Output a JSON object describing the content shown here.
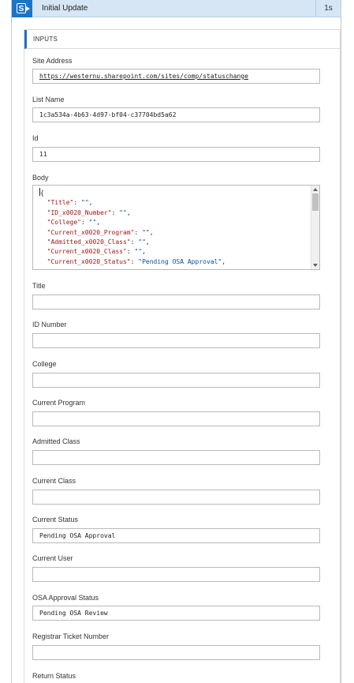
{
  "header": {
    "title": "Initial Update",
    "duration": "1s",
    "icon": "sharepoint-icon",
    "accent_color": "#1e74c4",
    "header_bg": "#d6e6f5"
  },
  "inputs": {
    "section_label": "INPUTS",
    "site_address": {
      "label": "Site Address",
      "value": "https://westernu.sharepoint.com/sites/comp/statuschange"
    },
    "list_name": {
      "label": "List Name",
      "value": "1c3a534a-4b63-4d97-bf04-c37704bd5a62"
    },
    "id": {
      "label": "Id",
      "value": "11"
    },
    "body": {
      "label": "Body",
      "open_brace": "{",
      "lines": [
        {
          "key": "\"Title\"",
          "value": "\"\""
        },
        {
          "key": "\"ID_x0020_Number\"",
          "value": "\"\""
        },
        {
          "key": "\"College\"",
          "value": "\"\""
        },
        {
          "key": "\"Current_x0020_Program\"",
          "value": "\"\""
        },
        {
          "key": "\"Admitted_x0020_Class\"",
          "value": "\"\""
        },
        {
          "key": "\"Current_x0020_Class\"",
          "value": "\"\""
        },
        {
          "key": "\"Current_x0020_Status\"",
          "value": "\"Pending OSA Approval\""
        }
      ]
    },
    "title": {
      "label": "Title",
      "value": ""
    },
    "id_number": {
      "label": "ID Number",
      "value": ""
    },
    "college": {
      "label": "College",
      "value": ""
    },
    "current_program": {
      "label": "Current Program",
      "value": ""
    },
    "admitted_class": {
      "label": "Admitted Class",
      "value": ""
    },
    "current_class": {
      "label": "Current Class",
      "value": ""
    },
    "current_status": {
      "label": "Current Status",
      "value": "Pending OSA Approval"
    },
    "current_user": {
      "label": "Current User",
      "value": ""
    },
    "osa_approval_status": {
      "label": "OSA Approval Status",
      "value": "Pending OSA Review"
    },
    "registrar_ticket_number": {
      "label": "Registrar Ticket Number",
      "value": ""
    },
    "return_status": {
      "label": "Return Status"
    }
  }
}
